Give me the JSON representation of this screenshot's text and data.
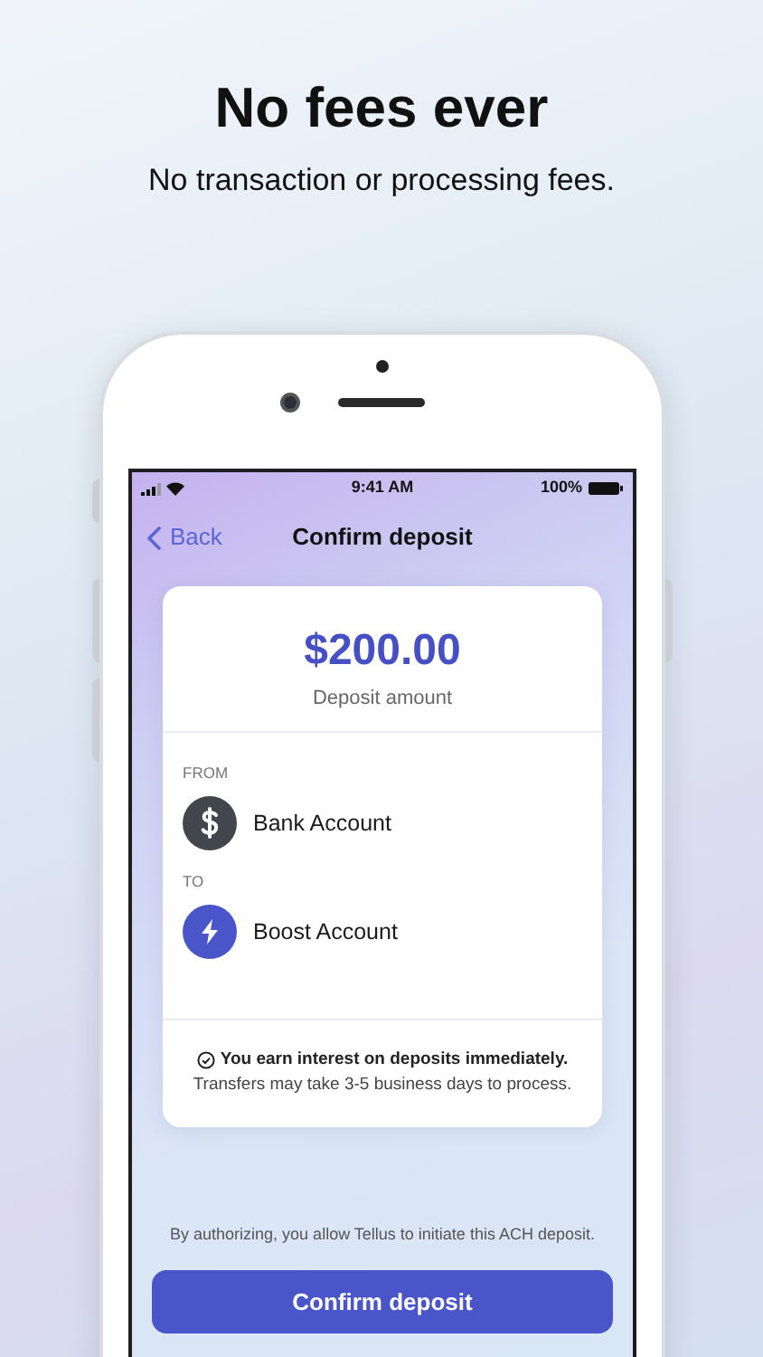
{
  "header": {
    "title": "No fees ever",
    "subtitle": "No transaction or processing fees."
  },
  "status_bar": {
    "time": "9:41 AM",
    "battery": "100%"
  },
  "nav": {
    "back": "Back",
    "title": "Confirm deposit"
  },
  "amount": {
    "value": "$200.00",
    "label": "Deposit amount"
  },
  "accounts": [
    {
      "heading": "FROM",
      "name": "Bank Account",
      "kind": "bank"
    },
    {
      "heading": "TO",
      "name": "Boost Account",
      "kind": "boost"
    }
  ],
  "notice": {
    "headline": "You earn interest on deposits immediately.",
    "detail": "Transfers may take 3-5 business days to process."
  },
  "disclaimer": "By authorizing, you allow Tellus to initiate this ACH deposit.",
  "button": "Confirm deposit"
}
